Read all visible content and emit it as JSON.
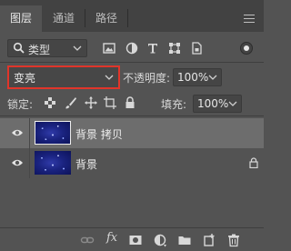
{
  "tabs": [
    {
      "label": "图层",
      "active": true
    },
    {
      "label": "通道",
      "active": false
    },
    {
      "label": "路径",
      "active": false
    }
  ],
  "filter": {
    "kind_label": "类型",
    "icons": [
      "image-filter-icon",
      "adjustment-filter-icon",
      "type-filter-icon",
      "shape-filter-icon",
      "smart-object-filter-icon"
    ],
    "toggle_on": true
  },
  "blend": {
    "mode": "变亮",
    "highlight_color": "#e0352a",
    "opacity_label": "不透明度:",
    "opacity_value": "100%"
  },
  "lock": {
    "label": "锁定:",
    "icons": [
      "lock-transparent-pixels-icon",
      "lock-image-pixels-icon",
      "lock-position-icon",
      "lock-artboard-icon",
      "lock-all-icon"
    ],
    "fill_label": "填充:",
    "fill_value": "100%"
  },
  "layers": [
    {
      "name": "背景 拷贝",
      "visible": true,
      "selected": true,
      "locked": false
    },
    {
      "name": "背景",
      "visible": true,
      "selected": false,
      "locked": true
    }
  ],
  "bottom_bar": {
    "fx_label": "fx",
    "icons": [
      "link-layers-icon",
      "layer-style-fx-icon",
      "add-mask-icon",
      "adjustment-layer-icon",
      "new-group-icon",
      "new-layer-icon",
      "delete-icon"
    ]
  }
}
